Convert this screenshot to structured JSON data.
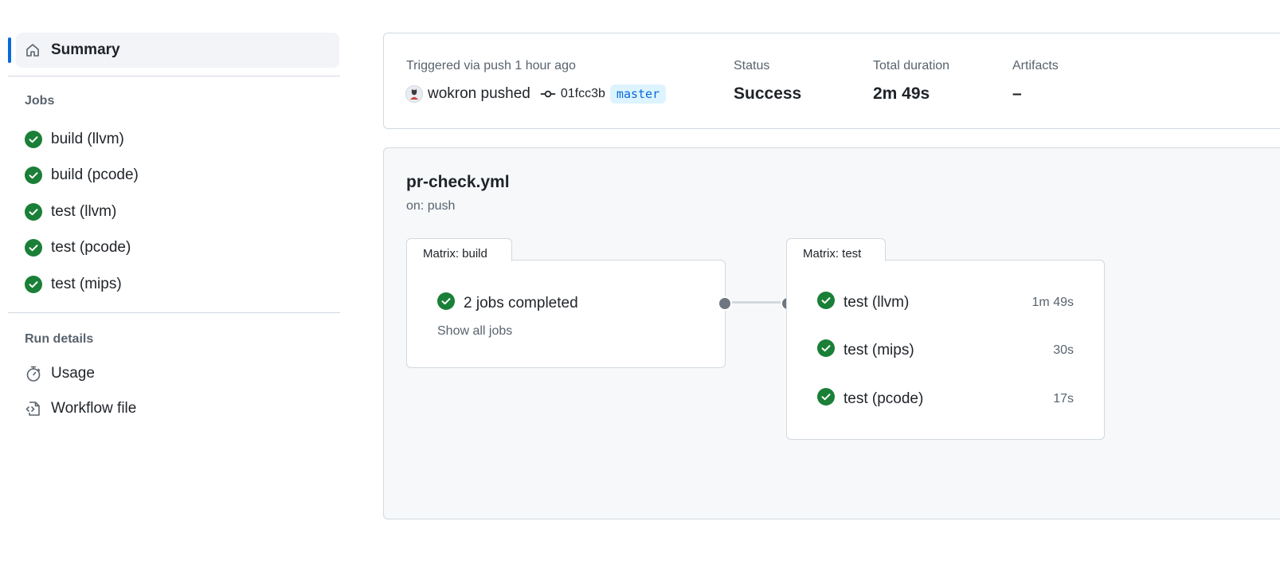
{
  "sidebar": {
    "summary_label": "Summary",
    "jobs_title": "Jobs",
    "jobs": [
      {
        "label": "build (llvm)",
        "status": "success"
      },
      {
        "label": "build (pcode)",
        "status": "success"
      },
      {
        "label": "test (llvm)",
        "status": "success"
      },
      {
        "label": "test (pcode)",
        "status": "success"
      },
      {
        "label": "test (mips)",
        "status": "success"
      }
    ],
    "run_details_title": "Run details",
    "run_details": [
      {
        "label": "Usage",
        "icon": "stopwatch-icon"
      },
      {
        "label": "Workflow file",
        "icon": "file-code-icon"
      }
    ]
  },
  "header": {
    "trigger_text": "Triggered via push 1 hour ago",
    "pusher_text": "wokron pushed",
    "commit_sha": "01fcc3b",
    "branch": "master",
    "status_label": "Status",
    "status_value": "Success",
    "duration_label": "Total duration",
    "duration_value": "2m 49s",
    "artifacts_label": "Artifacts",
    "artifacts_value": "–"
  },
  "workflow": {
    "name": "pr-check.yml",
    "trigger": "on: push",
    "build_matrix": {
      "title": "Matrix: build",
      "summary": "2 jobs completed",
      "show_all": "Show all jobs"
    },
    "test_matrix": {
      "title": "Matrix: test",
      "jobs": [
        {
          "label": "test (llvm)",
          "duration": "1m 49s"
        },
        {
          "label": "test (mips)",
          "duration": "30s"
        },
        {
          "label": "test (pcode)",
          "duration": "17s"
        }
      ]
    }
  },
  "colors": {
    "success": "#1a7f37",
    "accent": "#0969da",
    "border": "#d1d9e0",
    "muted": "#59636e"
  }
}
